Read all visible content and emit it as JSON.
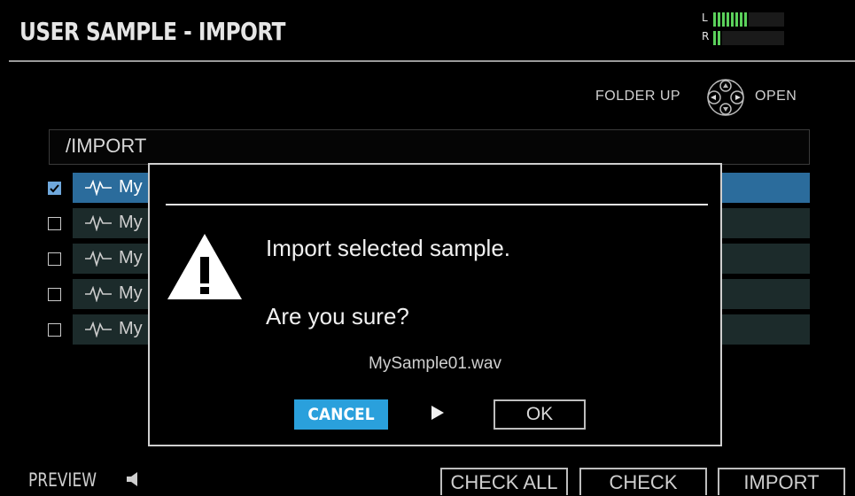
{
  "header": {
    "title": "USER SAMPLE - IMPORT",
    "meter": {
      "left_label": "L",
      "right_label": "R",
      "left_level": 0.5,
      "right_level": 0.12,
      "color": "#5bd15b"
    }
  },
  "nav_hint": {
    "folder_up": "FOLDER UP",
    "open": "OPEN",
    "icon": "dpad-icon"
  },
  "path": "/IMPORT",
  "files": [
    {
      "name": "My",
      "checked": true,
      "selected": true
    },
    {
      "name": "My",
      "checked": false,
      "selected": false
    },
    {
      "name": "My",
      "checked": false,
      "selected": false
    },
    {
      "name": "My",
      "checked": false,
      "selected": false
    },
    {
      "name": "My",
      "checked": false,
      "selected": false
    }
  ],
  "dialog": {
    "message1": "Import selected sample.",
    "message2": "Are you sure?",
    "filename": "MySample01.wav",
    "cancel_label": "CANCEL",
    "ok_label": "OK",
    "icon": "warning-icon"
  },
  "footer": {
    "preview_label": "PREVIEW",
    "check_all_label": "CHECK ALL",
    "check_label": "CHECK",
    "import_label": "IMPORT"
  },
  "colors": {
    "accent": "#2aa0dc",
    "selected_row": "#2b6c9c",
    "row": "#1c2b2b",
    "checkbox_checked": "#6fa8dc"
  }
}
